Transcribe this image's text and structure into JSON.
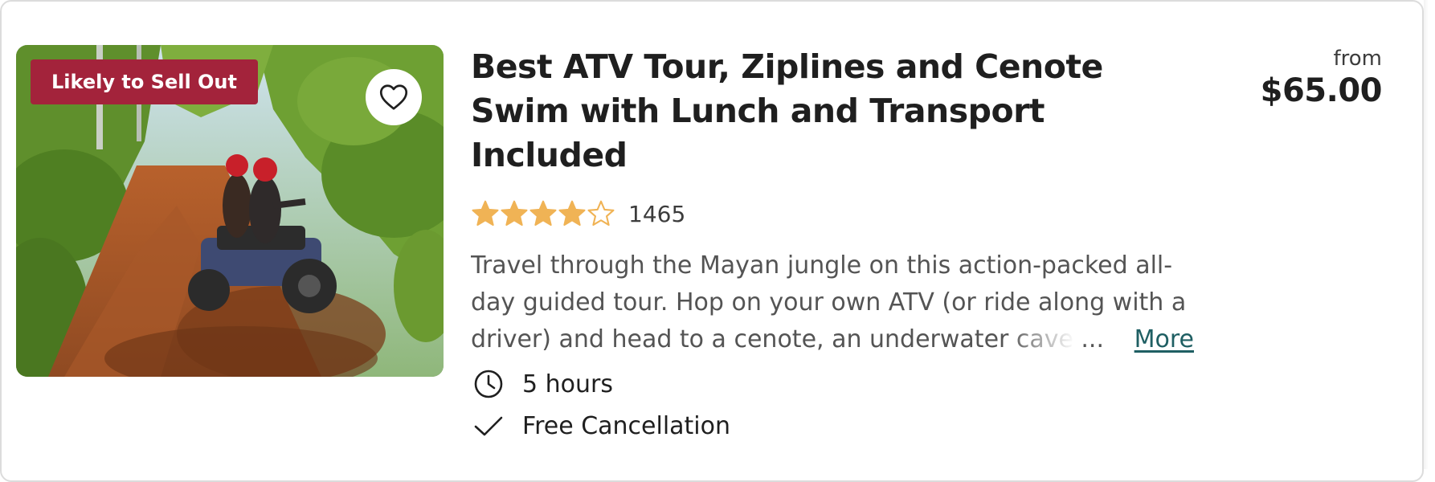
{
  "listing": {
    "badge": {
      "label": "Likely to Sell Out",
      "color": "#a3233b"
    },
    "wishlist_icon": "heart-outline-icon",
    "title": "Best ATV Tour, Ziplines and Cenote Swim with Lunch and Transport Included",
    "rating": {
      "stars": 4,
      "max_stars": 5,
      "star_color": "#f0b355",
      "review_count": "1465"
    },
    "description": {
      "text": "Travel through the Mayan jungle on this action-packed all-day guided tour. Hop on your own ATV (or ride along with a driver) and head to a cenote, an underwater cave",
      "ellipsis": "...",
      "more_label": "More",
      "link_color": "#1f5f63"
    },
    "features": [
      {
        "icon": "clock-icon",
        "label": "5 hours"
      },
      {
        "icon": "checkmark-icon",
        "label": "Free Cancellation"
      }
    ],
    "price": {
      "prefix": "from",
      "amount": "$65.00"
    }
  }
}
